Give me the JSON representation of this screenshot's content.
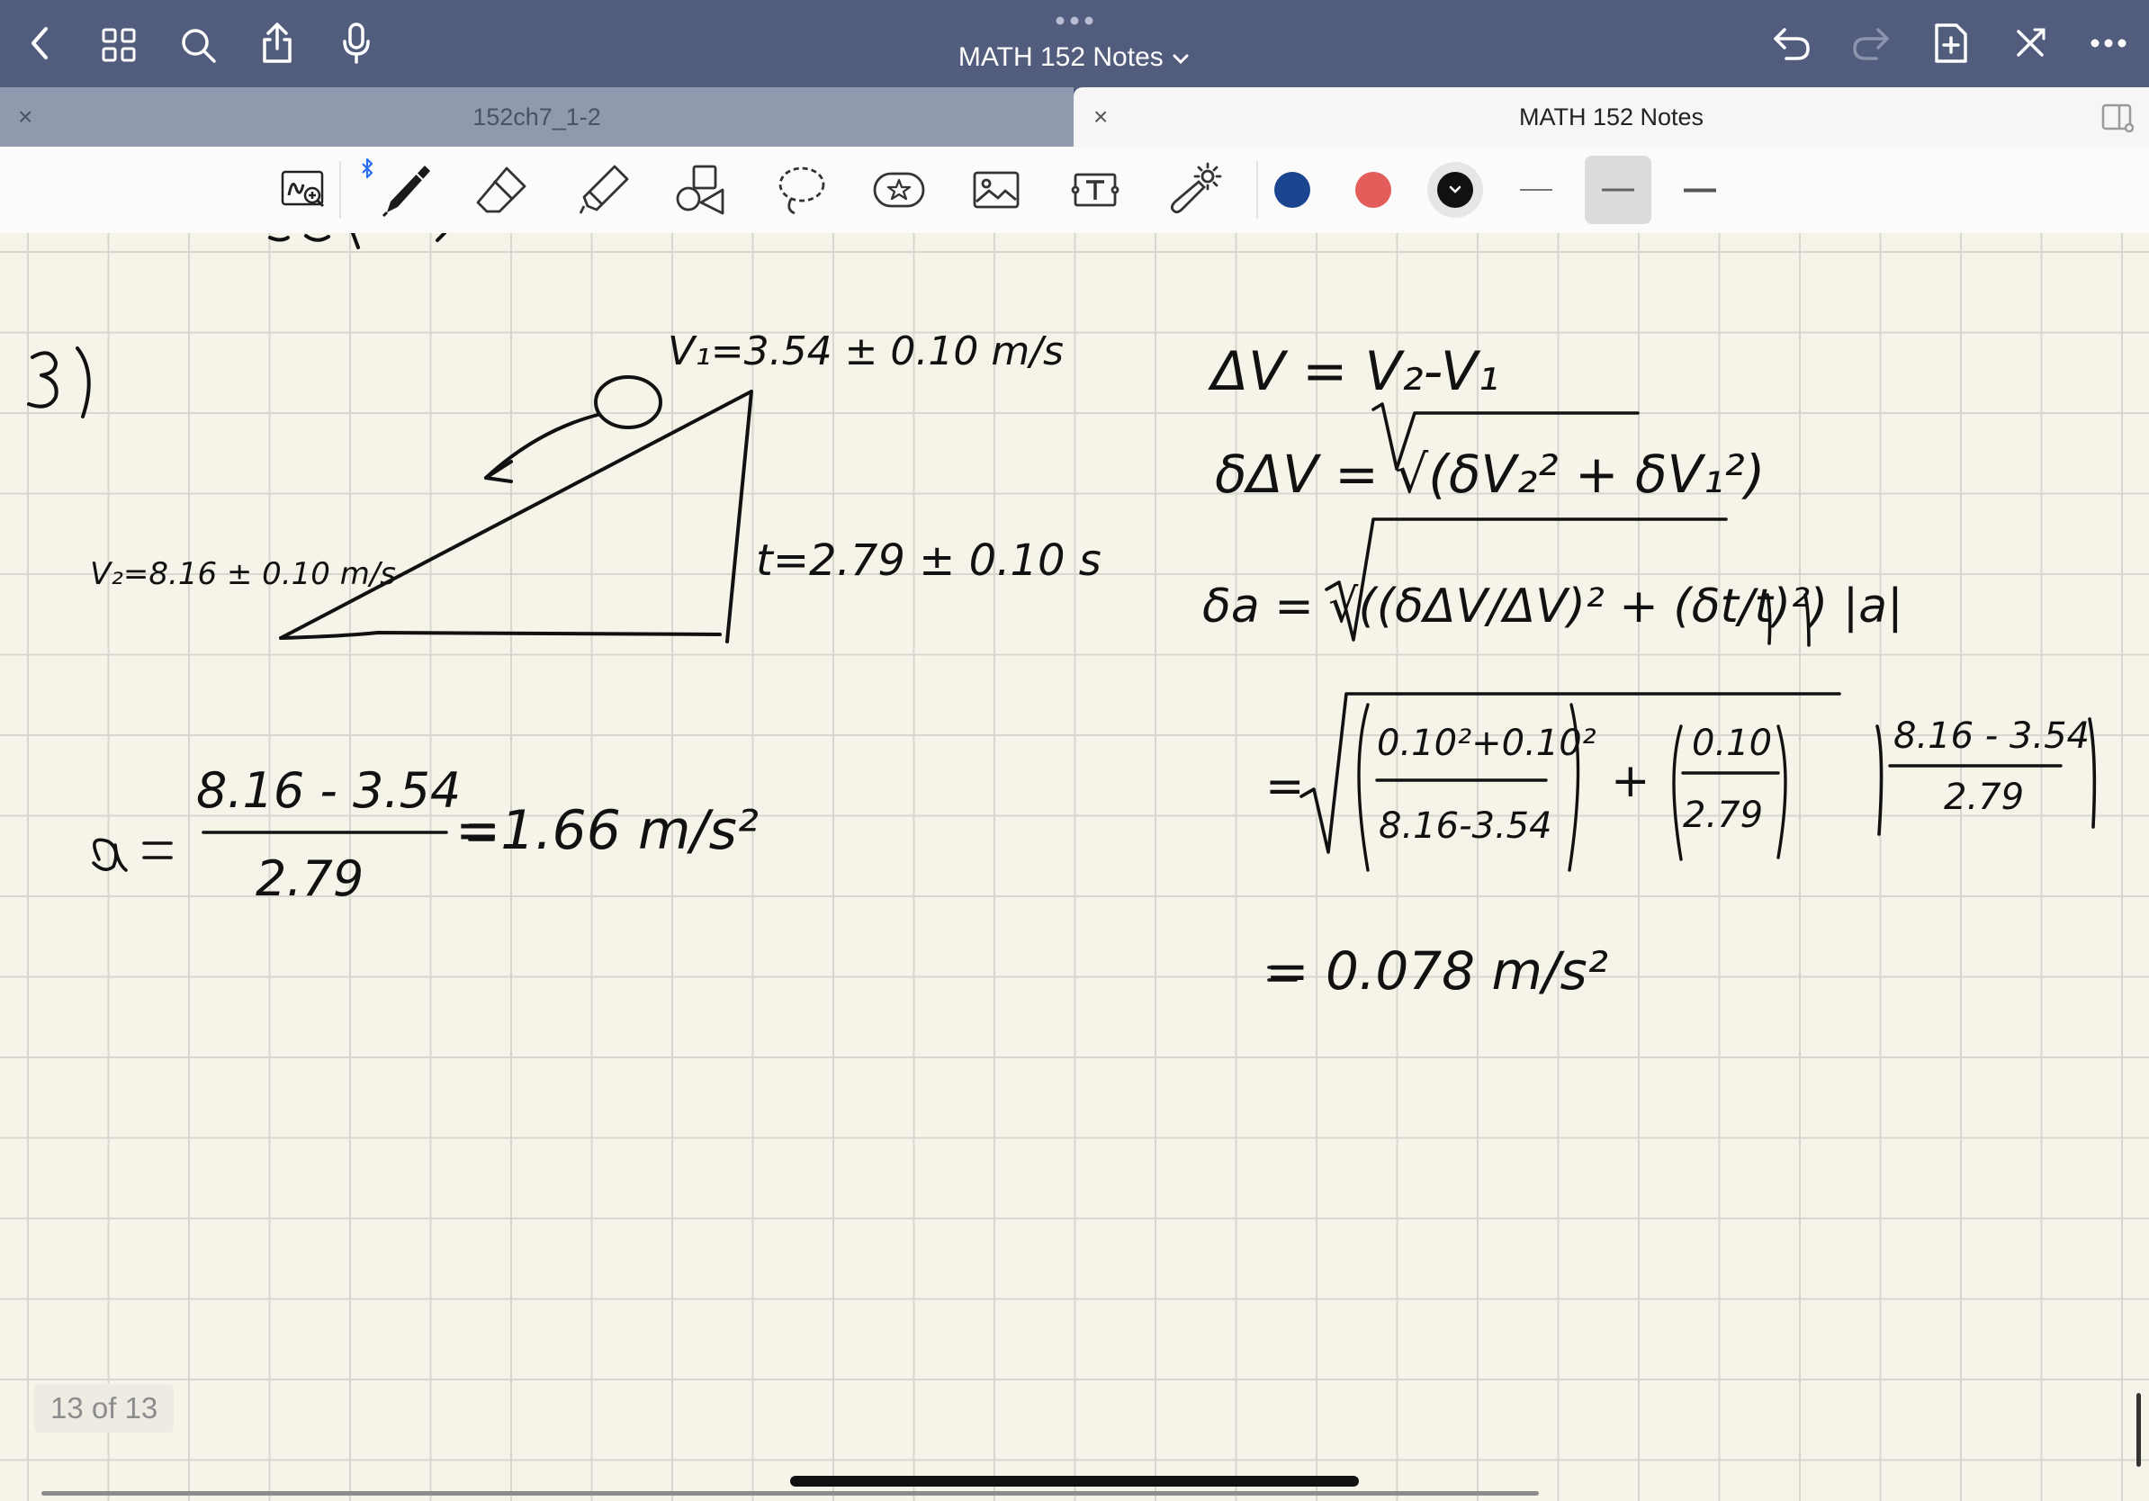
{
  "header": {
    "title": "MATH 152 Notes",
    "icons": [
      "back-icon",
      "grid-icon",
      "search-icon",
      "share-icon",
      "microphone-icon",
      "undo-icon",
      "redo-icon",
      "add-page-icon",
      "close-toolbar-icon",
      "more-icon"
    ]
  },
  "tabs": [
    {
      "label": "152ch7_1-2",
      "close": "×",
      "active": false
    },
    {
      "label": "MATH 152 Notes",
      "close": "×",
      "active": true
    }
  ],
  "toolbar": {
    "tools": [
      "zoom-window",
      "pen",
      "eraser",
      "highlighter",
      "shapes",
      "lasso",
      "elements",
      "image",
      "text",
      "laser-pointer"
    ],
    "colors": [
      "#1b468f",
      "#e35d5b",
      "#111111"
    ],
    "selected_color": "#111111",
    "stroke_widths": [
      "thin",
      "medium",
      "thick"
    ],
    "selected_stroke": "medium"
  },
  "notes": {
    "problem_number": "3)",
    "v1": "V₁=3.54 ± 0.10 m/s",
    "v2": "V₂=8.16 ± 0.10 m/s",
    "t": "t=2.79 ± 0.10 s",
    "accel_numerator": "8.16 - 3.54",
    "accel_denominator": "2.79",
    "accel_result": "=1.66 m/s²",
    "delta_v": "ΔV = V₂-V₁",
    "delta_v_error": "δΔV = √(δV₂² + δV₁²)",
    "delta_a_formula": "δa = √((δΔV/ΔV)² + (δt/t)²) |a|",
    "final_result": "= 0.078 m/s²"
  },
  "footer": {
    "page_indicator": "13 of 13"
  }
}
